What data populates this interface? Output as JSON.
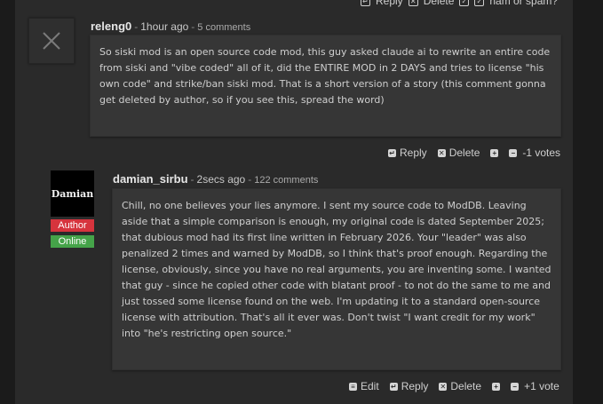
{
  "top_actions": {
    "reply": "Reply",
    "delete": "Delete",
    "spam": "ham or spam?"
  },
  "comment1": {
    "author": "releng0",
    "time": "1hour ago",
    "comments_count": "5 comments",
    "body": "So siski mod is an open source code mod, this guy asked claude ai to rewrite an entire code from siski and \"vibe coded\" all of it, did the ENTIRE MOD in 2 DAYS and tries to license \"his own code\" and strike/ban siski mod. That is a short version of a story (this comment gonna get deleted by author, so if you see this, spread the word)",
    "actions": {
      "reply": "Reply",
      "delete": "Delete"
    },
    "votes": "-1 votes"
  },
  "comment2": {
    "author": "damian_sirbu",
    "time": "2secs ago",
    "comments_count": "122 comments",
    "avatar_text": "Damian",
    "badge_author": "Author",
    "badge_online": "Online",
    "body": "Chill, no one believes your lies anymore. I sent my source code to ModDB. Leaving aside that a simple comparison is enough, my original code is dated September 2025; that dubious mod had its first line written in February 2026. Your \"leader\" was also penalized 2 times and warned by ModDB, so I think that's proof enough. Regarding the license, obviously, since you have no real arguments, you are inventing some. I wanted that guy - since he copied other code with blatant proof - to not do the same to me and just tossed some license found on the web. I'm updating it to a standard open-source license with attribution. That's all it ever was. Don't twist \"I want credit for my work\" into \"he's restricting open source.\"",
    "actions": {
      "edit": "Edit",
      "reply": "Reply",
      "delete": "Delete"
    },
    "votes": "+1 vote"
  }
}
